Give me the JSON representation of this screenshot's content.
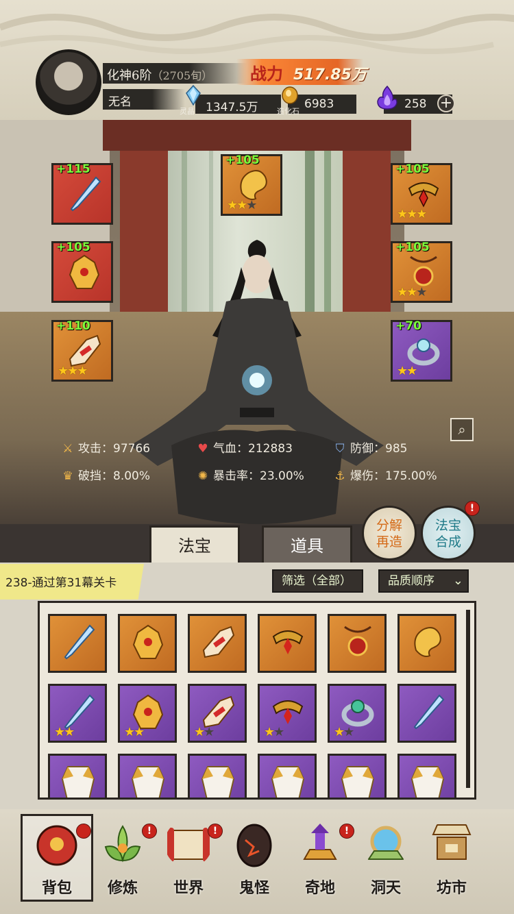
{
  "player": {
    "realm": "化神6阶",
    "realm_age": "（2705旬）",
    "name": "无名",
    "power_label": "战力",
    "power_value": "517.85万"
  },
  "resources": [
    {
      "icon": "spirit-crystal-icon",
      "label": "灵晶",
      "value": "1347.5万"
    },
    {
      "icon": "creation-stone-icon",
      "label": "造化石",
      "value": "6983"
    },
    {
      "icon": "purple-flame-icon",
      "label": "",
      "value": "258"
    }
  ],
  "equipment": [
    {
      "slot": "left-1",
      "bonus": "+115",
      "rarity": "red",
      "stars": 0,
      "icon": "sword-icon"
    },
    {
      "slot": "left-2",
      "bonus": "+105",
      "rarity": "red",
      "stars": 0,
      "icon": "golden-armor-icon"
    },
    {
      "slot": "left-3",
      "bonus": "+110",
      "rarity": "orange",
      "stars": 3,
      "icon": "winged-boot-icon"
    },
    {
      "slot": "top",
      "bonus": "+105",
      "rarity": "orange",
      "stars": 2,
      "icon": "golden-beast-icon"
    },
    {
      "slot": "right-1",
      "bonus": "+105",
      "rarity": "orange",
      "stars": 3,
      "icon": "circlet-icon"
    },
    {
      "slot": "right-2",
      "bonus": "+105",
      "rarity": "orange",
      "stars": 2,
      "icon": "pendant-icon"
    },
    {
      "slot": "right-3",
      "bonus": "+70",
      "rarity": "purple",
      "stars": 2,
      "icon": "jade-ring-icon"
    }
  ],
  "stats": [
    {
      "icon": "sword-icon",
      "label": "攻击",
      "value": "97766"
    },
    {
      "icon": "heart-icon",
      "label": "气血",
      "value": "212883"
    },
    {
      "icon": "shield-icon",
      "label": "防御",
      "value": "985"
    },
    {
      "icon": "crown-icon",
      "label": "破挡",
      "value": "8.00%"
    },
    {
      "icon": "burst-icon",
      "label": "暴击率",
      "value": "23.00%"
    },
    {
      "icon": "anchor-icon",
      "label": "爆伤",
      "value": "175.00%"
    }
  ],
  "tabs": [
    {
      "label": "法宝",
      "active": true
    },
    {
      "label": "道具",
      "active": false
    }
  ],
  "action_buttons": {
    "decompose_line1": "分解",
    "decompose_line2": "再造",
    "craft_line1": "法宝",
    "craft_line2": "合成",
    "craft_badge": "!"
  },
  "quest": "238-通过第31幕关卡",
  "filters": {
    "filter_label": "筛选（全部）",
    "sort_label": "品质顺序"
  },
  "inventory": [
    {
      "rarity": "orange",
      "icon": "sword-icon",
      "stars": 0
    },
    {
      "rarity": "orange",
      "icon": "golden-armor-icon",
      "stars": 0
    },
    {
      "rarity": "orange",
      "icon": "winged-boot-icon",
      "stars": 0
    },
    {
      "rarity": "orange",
      "icon": "circlet-icon",
      "stars": 0
    },
    {
      "rarity": "orange",
      "icon": "pendant-icon",
      "stars": 0
    },
    {
      "rarity": "orange",
      "icon": "golden-beast-icon",
      "stars": 0
    },
    {
      "rarity": "purple",
      "icon": "sword-icon",
      "stars": 2
    },
    {
      "rarity": "purple",
      "icon": "golden-armor-icon",
      "stars": 2
    },
    {
      "rarity": "purple",
      "icon": "winged-boot-icon",
      "stars": 1
    },
    {
      "rarity": "purple",
      "icon": "circlet-icon",
      "stars": 1
    },
    {
      "rarity": "purple",
      "icon": "jade-ring-icon",
      "stars": 1
    },
    {
      "rarity": "purple",
      "icon": "sword-icon",
      "stars": 0
    },
    {
      "rarity": "purple",
      "icon": "robe-armor-icon",
      "stars": 0
    },
    {
      "rarity": "purple",
      "icon": "robe-armor-icon",
      "stars": 0
    },
    {
      "rarity": "purple",
      "icon": "robe-armor-icon",
      "stars": 0
    },
    {
      "rarity": "purple",
      "icon": "robe-armor-icon",
      "stars": 0
    },
    {
      "rarity": "purple",
      "icon": "robe-armor-icon",
      "stars": 0
    },
    {
      "rarity": "purple",
      "icon": "robe-armor-icon",
      "stars": 0
    }
  ],
  "nav": [
    {
      "label": "背包",
      "icon": "bag-icon",
      "badge": true,
      "selected": true
    },
    {
      "label": "修炼",
      "icon": "lotus-icon",
      "badge": true,
      "selected": false
    },
    {
      "label": "世界",
      "icon": "scroll-map-icon",
      "badge": true,
      "selected": false
    },
    {
      "label": "鬼怪",
      "icon": "demon-egg-icon",
      "badge": false,
      "selected": false
    },
    {
      "label": "奇地",
      "icon": "pagoda-icon",
      "badge": true,
      "selected": false
    },
    {
      "label": "洞天",
      "icon": "portal-icon",
      "badge": false,
      "selected": false
    },
    {
      "label": "坊市",
      "icon": "market-stall-icon",
      "badge": false,
      "selected": false
    }
  ],
  "colors": {
    "red_rarity": "#d44a3a",
    "orange_rarity": "#e09138",
    "purple_rarity": "#8e5ac0",
    "bonus_green": "#7cff3c",
    "star_gold": "#ffc61a",
    "power_orange": "#ff7a1e"
  }
}
